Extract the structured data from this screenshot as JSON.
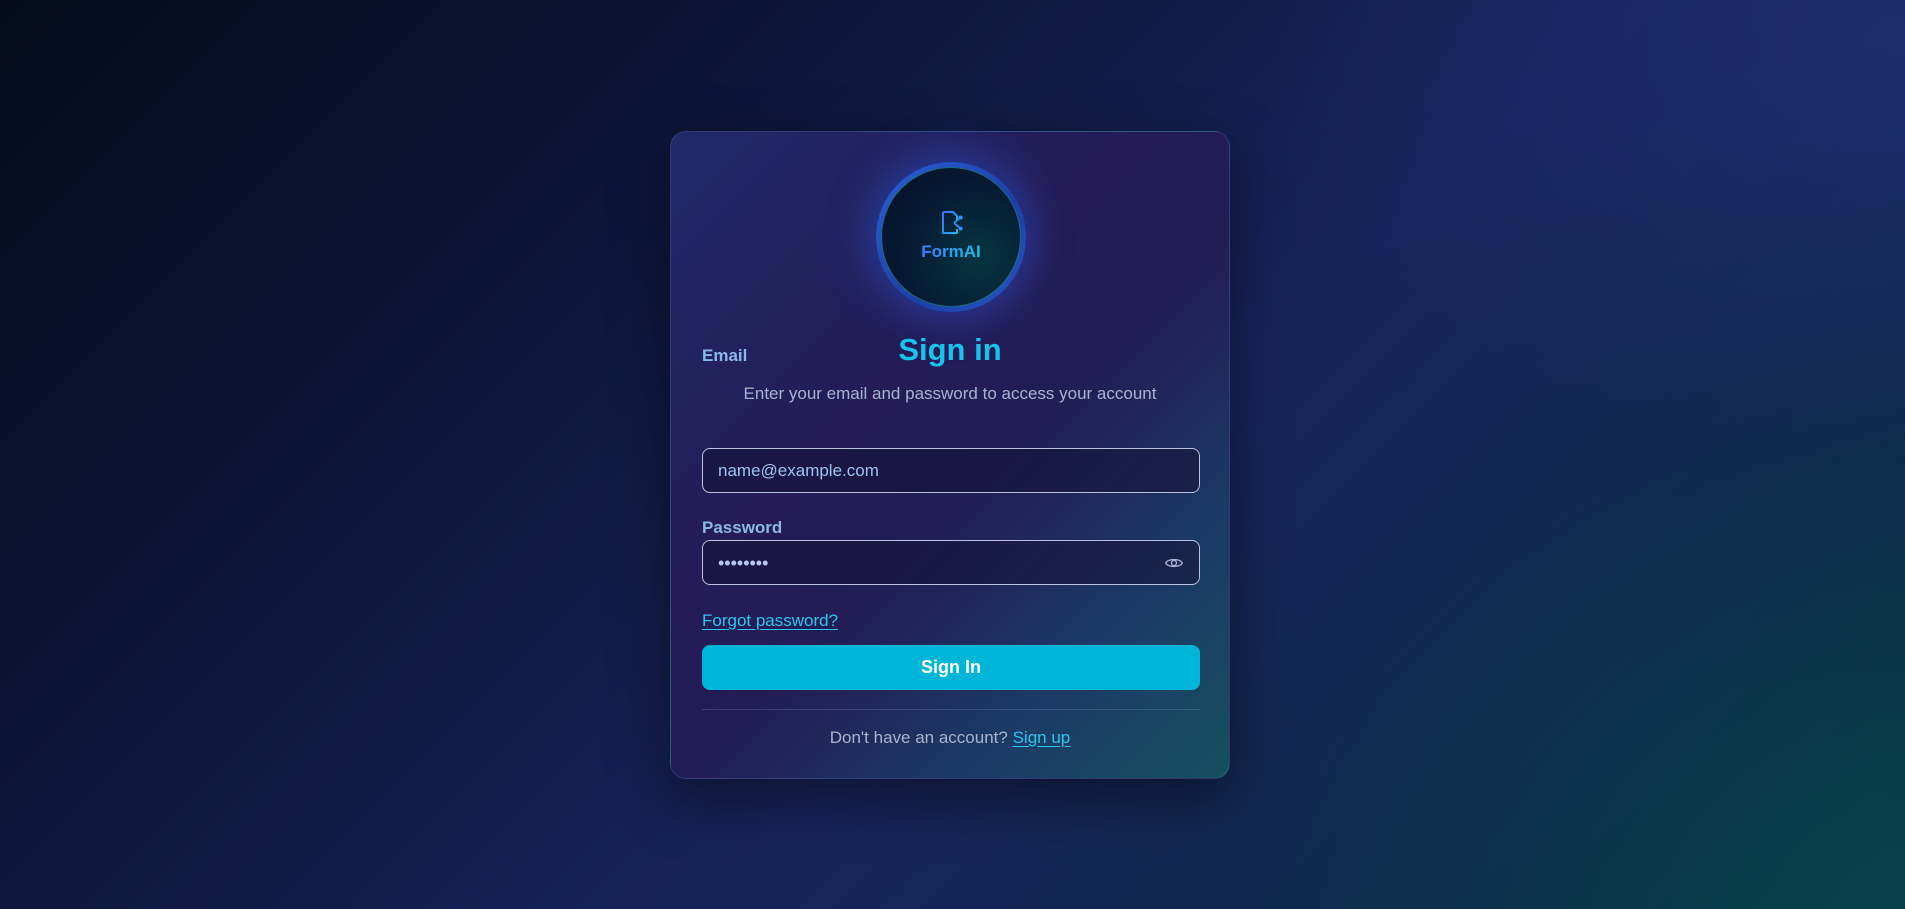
{
  "logo": {
    "text": "FormAI",
    "icon": "form-document-icon"
  },
  "header": {
    "title": "Sign in",
    "subtitle": "Enter your email and password to access your account"
  },
  "form": {
    "email": {
      "label": "Email",
      "placeholder": "name@example.com",
      "value": ""
    },
    "password": {
      "label": "Password",
      "masked_value": "••••••••",
      "toggle_icon": "eye-icon"
    },
    "forgot_label": "Forgot password?",
    "submit_label": "Sign In"
  },
  "footer": {
    "prompt": "Don't have an account?",
    "link_label": "Sign up"
  },
  "colors": {
    "accent": "#00b6d8",
    "title": "#16c3ea",
    "link": "#2bc6f0"
  }
}
